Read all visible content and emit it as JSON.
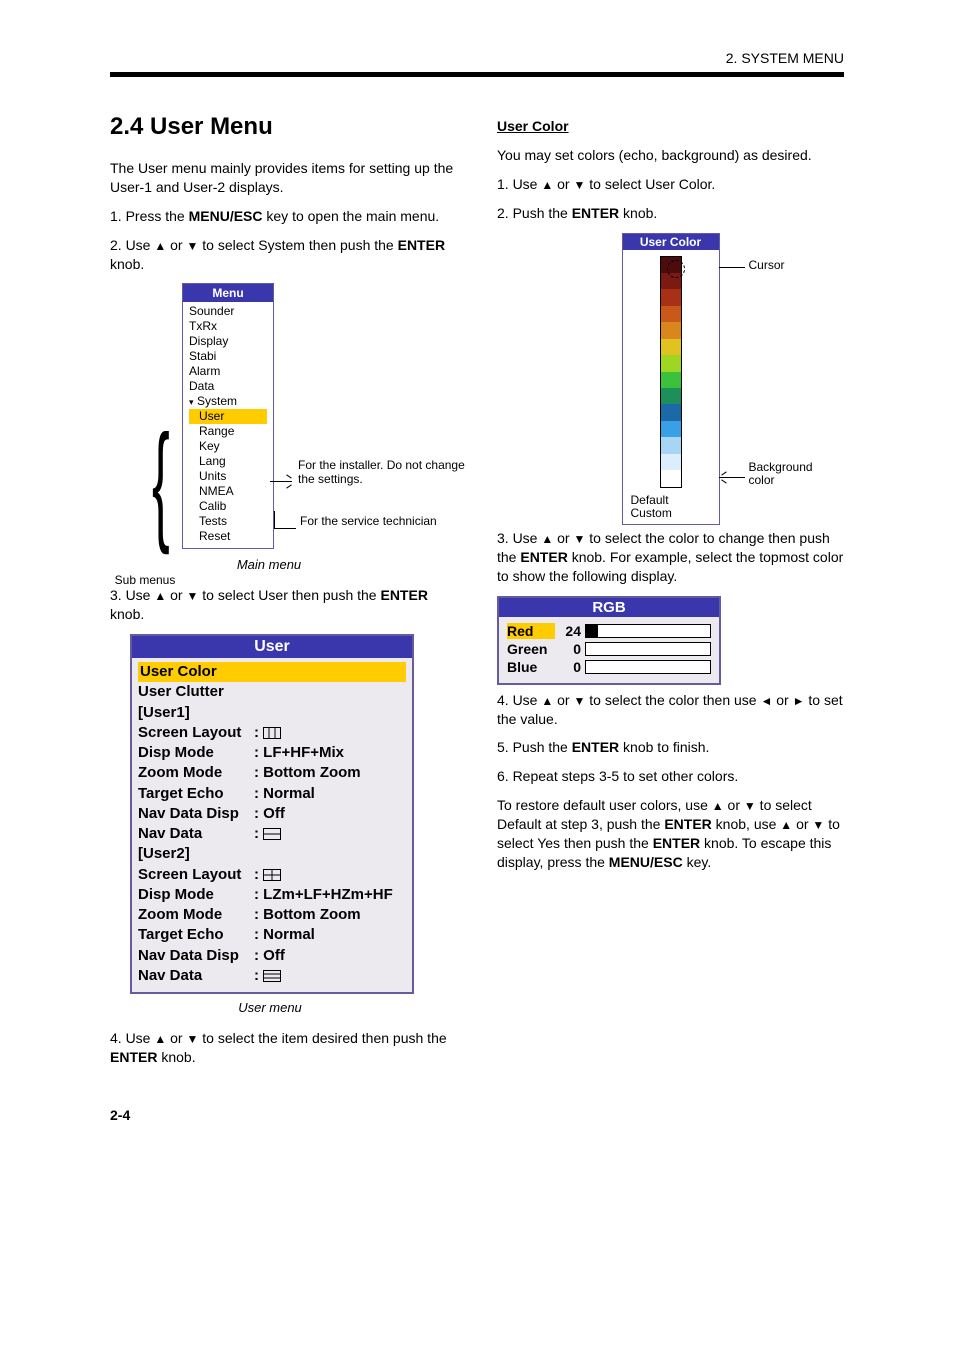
{
  "page_label": "2. SYSTEM MENU",
  "page_number": "2-4",
  "section_title": "2.4 User Menu",
  "intro_para": "The User menu mainly provides items for setting up the User-1 and User-2 displays.",
  "step1a": "1. Press the ",
  "step1b": "MENU/ESC",
  "step1c": " key to open the main menu.",
  "step2a": "2. Use ",
  "step2b": " or ",
  "step2c": " to select System then push the ",
  "step2d": "ENTER",
  "step2e": " knob.",
  "menu_title": "Menu",
  "menu_items": [
    "Sounder",
    "TxRx",
    "Display",
    "Stabi",
    "Alarm",
    "Data",
    "System"
  ],
  "menu_sub_items": [
    "User",
    "Range",
    "Key",
    "Lang",
    "Units",
    "NMEA",
    "Calib",
    "Tests",
    "Reset"
  ],
  "menu_sub_highlight_index": 0,
  "subm_label": "Sub menus",
  "ann_installer": "For the installer. Do not change the settings.",
  "ann_service": "For the service technician",
  "menu_caption": "Main menu",
  "step3a": "3. Use ",
  "step3b": " or ",
  "step3c": " to select User then push the ",
  "step3d": "ENTER",
  "step3e": " knob.",
  "user_title": "User",
  "user_menu": {
    "highlight": "User Color",
    "clutter": "User Clutter",
    "user1_tag": "[User1]",
    "user2_tag": "[User2]",
    "rows1": [
      {
        "label": "Screen Layout",
        "value": "ICON3"
      },
      {
        "label": "Disp Mode",
        "value": "LF+HF+Mix"
      },
      {
        "label": "Zoom Mode",
        "value": "Bottom Zoom"
      },
      {
        "label": "Target Echo",
        "value": "Normal"
      },
      {
        "label": "Nav Data Disp",
        "value": "Off"
      },
      {
        "label": "Nav Data",
        "value": "ICON1x2"
      }
    ],
    "rows2": [
      {
        "label": "Screen Layout",
        "value": "ICON2x2"
      },
      {
        "label": "Disp Mode",
        "value": "LZm+LF+HZm+HF"
      },
      {
        "label": "Zoom Mode",
        "value": "Bottom Zoom"
      },
      {
        "label": "Target Echo",
        "value": "Normal"
      },
      {
        "label": "Nav Data Disp",
        "value": "Off"
      },
      {
        "label": "Nav Data",
        "value": "ICON1x3"
      }
    ]
  },
  "user_caption": "User menu",
  "step4a": "4. Use ",
  "step4b": " or ",
  "step4c": " to select the item desired then push the ",
  "step4d": "ENTER",
  "step4e": " knob.",
  "uc_heading": "User Color",
  "uc_para1": "You may set colors (echo, background) as desired.",
  "uc_step1a": "1. Use ",
  "uc_step1b": " or ",
  "uc_step1c": " to select User Color.",
  "uc_step2a": "2. Push the ",
  "uc_step2b": "ENTER",
  "uc_step2c": " knob.",
  "color_title": "User Color",
  "color_cursor_label": "Cursor",
  "color_default": "Default",
  "color_custom": "Custom",
  "color_bg_label": "Background color",
  "uc_step3a": "3. Use ",
  "uc_step3b": " or ",
  "uc_step3c": " to select the color to change then push the ",
  "uc_step3d": "ENTER",
  "uc_step3e": " knob. For example, select the topmost color to show the following display.",
  "rgb_title": "RGB",
  "rgb": {
    "rows": [
      {
        "name": "Red",
        "value": 24,
        "hl": true,
        "pct": 10
      },
      {
        "name": "Green",
        "value": 0,
        "hl": false,
        "pct": 0
      },
      {
        "name": "Blue",
        "value": 0,
        "hl": false,
        "pct": 0
      }
    ]
  },
  "uc_step4a": "4. Use ",
  "uc_step4b": " or ",
  "uc_step4c": " to select the color then use ",
  "uc_step4d": " or ",
  "uc_step4e": " to set the value.",
  "uc_step5a": "5. Push the ",
  "uc_step5b": "ENTER",
  "uc_step5c": " knob to finish.",
  "uc_step6a": "6. Repeat steps 3-5 to set other colors.",
  "uc_note_a": "To restore default user colors, use ",
  "uc_note_b": " or ",
  "uc_note_c": " to select Default at step 3, push the ",
  "uc_note_d": "ENTER",
  "uc_note_e": " knob, use ",
  "uc_note_f": " or ",
  "uc_note_g": " to select Yes then push the ",
  "uc_note_h": "ENTER",
  "uc_note_i": " knob. To escape this display, press the ",
  "uc_note_j": "MENU/ESC",
  "uc_note_k": " key.",
  "color_bar": [
    "#4d0b0b",
    "#7a1a12",
    "#a83015",
    "#c85918",
    "#d9861d",
    "#e0c220",
    "#9fd623",
    "#3cc13c",
    "#1e8f5b",
    "#1c69a8",
    "#3aa0e6",
    "#a9d5f5",
    "#dceefb",
    "#ffffff"
  ]
}
